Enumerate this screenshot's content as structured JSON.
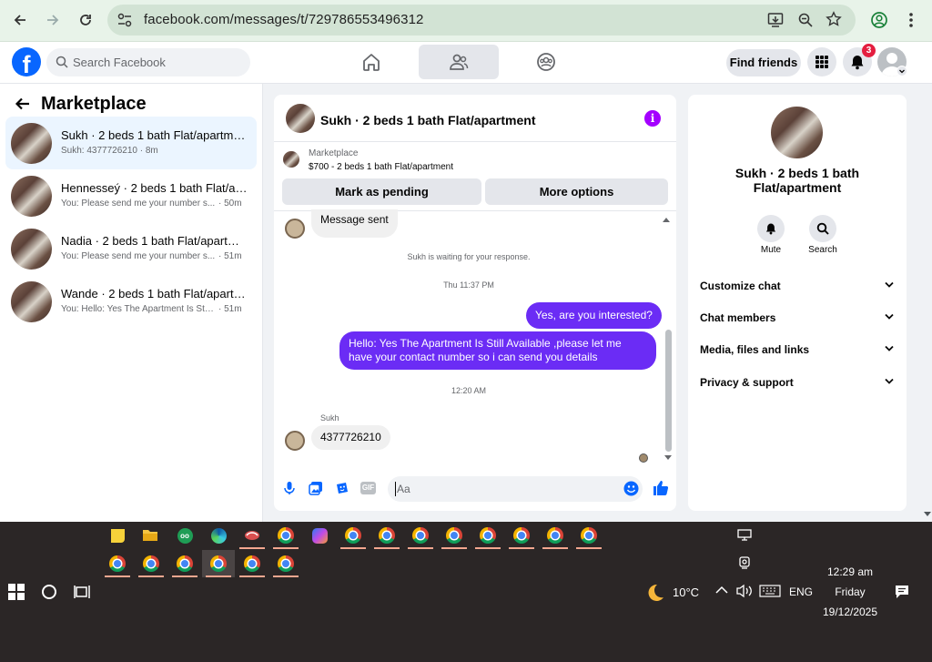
{
  "browser": {
    "url": "facebook.com/messages/t/729786553496312"
  },
  "fb_header": {
    "logo": "f",
    "search_placeholder": "Search Facebook",
    "find_friends": "Find friends",
    "notification_count": "3"
  },
  "sidebar": {
    "title": "Marketplace",
    "conversations": [
      {
        "name": "Sukh · 2 beds 1 bath Flat/apartment",
        "preview": "Sukh: 4377726210 · 8m",
        "time": ""
      },
      {
        "name": "Hennesseý · 2 beds 1 bath Flat/apa...",
        "preview": "You: Please send me your number s...",
        "time": "· 50m"
      },
      {
        "name": "Nadia · 2 beds 1 bath Flat/apartme...",
        "preview": "You: Please send me your number s...",
        "time": "· 51m"
      },
      {
        "name": "Wande · 2 beds 1 bath Flat/apartm...",
        "preview": "You: Hello: Yes The Apartment Is Still...",
        "time": "· 51m"
      }
    ]
  },
  "chat": {
    "title": "Sukh · 2 beds 1 bath Flat/apartment",
    "listing_label": "Marketplace",
    "listing_detail": "$700 - 2 beds 1 bath Flat/apartment",
    "mark_pending": "Mark as pending",
    "more_options": "More options",
    "message_sent": "Message sent",
    "waiting": "Sukh is waiting for your response.",
    "time1": "Thu 11:37 PM",
    "out_msg1": "Yes, are you interested?",
    "out_msg2": "Hello: Yes The Apartment Is Still Available ,please let me have your contact number so i can send you details",
    "time2": "12:20 AM",
    "sender": "Sukh",
    "in_msg": "4377726210",
    "composer_placeholder": "Aa"
  },
  "info": {
    "title": "Sukh · 2 beds 1 bath Flat/apartment",
    "mute": "Mute",
    "search": "Search",
    "sections": [
      "Customize chat",
      "Chat members",
      "Media, files and links",
      "Privacy & support"
    ]
  },
  "taskbar": {
    "weather_temp": "10°C",
    "lang": "ENG",
    "time": "12:29 am",
    "day": "Friday",
    "date": "19/12/2025"
  },
  "colors": {
    "accent": "#0866ff",
    "outgoing_bubble": "#6b2cf5",
    "notification": "#e41e3f"
  }
}
